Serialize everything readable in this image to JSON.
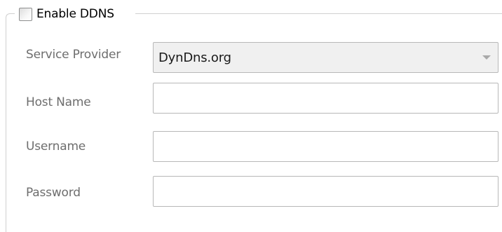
{
  "ddns": {
    "enable_label": "Enable DDNS",
    "enable_checked": false,
    "fields": {
      "service_provider": {
        "label": "Service Provider",
        "value": "DynDns.org"
      },
      "host_name": {
        "label": "Host Name",
        "value": ""
      },
      "username": {
        "label": "Username",
        "value": ""
      },
      "password": {
        "label": "Password",
        "value": ""
      }
    }
  },
  "icons": {
    "dropdown": "chevron-down-icon"
  }
}
